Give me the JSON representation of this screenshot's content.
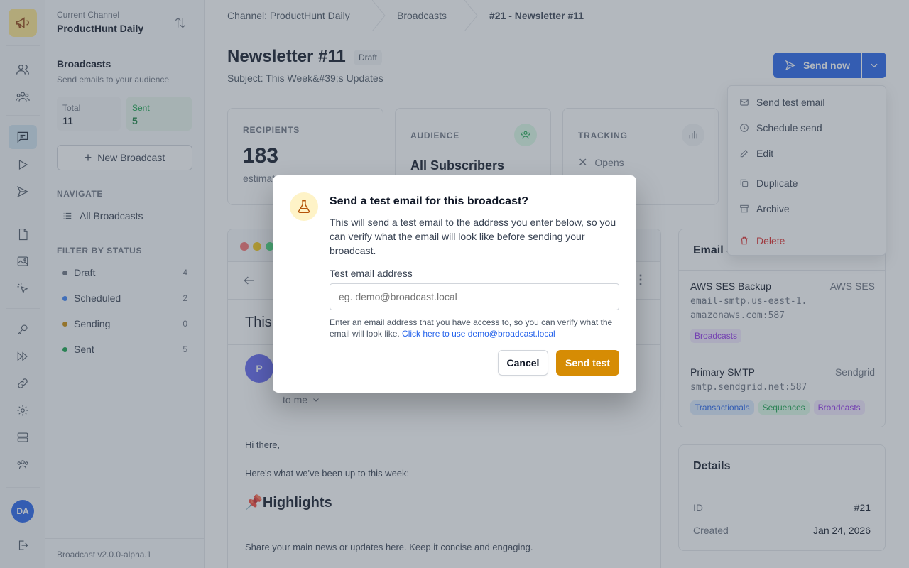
{
  "rail": {
    "avatar": "DA"
  },
  "sidebar": {
    "channel_caption": "Current Channel",
    "channel_name": "ProductHunt Daily",
    "section_title": "Broadcasts",
    "section_sub": "Send emails to your audience",
    "stats": {
      "total_label": "Total",
      "total_value": "11",
      "sent_label": "Sent",
      "sent_value": "5"
    },
    "new_button": "New Broadcast",
    "navigate_label": "NAVIGATE",
    "all_broadcasts": "All Broadcasts",
    "filter_label": "FILTER BY STATUS",
    "statuses": [
      {
        "label": "Draft",
        "count": "4",
        "color": "#6b7280"
      },
      {
        "label": "Scheduled",
        "count": "2",
        "color": "#3b82f6"
      },
      {
        "label": "Sending",
        "count": "0",
        "color": "#ca8a04"
      },
      {
        "label": "Sent",
        "count": "5",
        "color": "#16a34a"
      }
    ],
    "version": "Broadcast v2.0.0-alpha.1"
  },
  "breadcrumb": {
    "channel": "Channel: ProductHunt Daily",
    "broadcasts": "Broadcasts",
    "current": "#21 - Newsletter #11"
  },
  "header": {
    "title": "Newsletter #11",
    "badge": "Draft",
    "subject": "Subject: This Week&#39;s Updates",
    "send_now": "Send now"
  },
  "menu": {
    "items": [
      "Send test email",
      "Schedule send",
      "Edit",
      "Duplicate",
      "Archive",
      "Delete"
    ]
  },
  "stats_cards": {
    "recipients_label": "RECIPIENTS",
    "recipients_value": "183",
    "recipients_sub": "estimated",
    "audience_label": "AUDIENCE",
    "audience_value": "All Subscribers",
    "tracking_label": "TRACKING",
    "tracking_opens": "Opens"
  },
  "preview": {
    "subject_snippet": "This",
    "sender_initial": "P",
    "to_me": "to me",
    "greeting": "Hi there,",
    "intro": "Here's what we've been up to this week:",
    "highlights": "📌Highlights",
    "body": "Share your main news or updates here. Keep it concise and engaging."
  },
  "servers": {
    "title": "Email S",
    "items": [
      {
        "name": "AWS SES Backup",
        "provider": "AWS SES",
        "host": "email-smtp.us-east-1.amazonaws.com:587",
        "tags": [
          "Broadcasts"
        ]
      },
      {
        "name": "Primary SMTP",
        "provider": "Sendgrid",
        "host": "smtp.sendgrid.net:587",
        "tags": [
          "Transactionals",
          "Sequences",
          "Broadcasts"
        ]
      }
    ]
  },
  "details": {
    "title": "Details",
    "id_label": "ID",
    "id_value": "#21",
    "created_label": "Created",
    "created_value": "Jan 24, 2026"
  },
  "modal": {
    "title": "Send a test email for this broadcast?",
    "description": "This will send a test email to the address you enter below, so you can verify what the email will look like before sending your broadcast.",
    "field_label": "Test email address",
    "placeholder": "eg. demo@broadcast.local",
    "help_text": "Enter an email address that you have access to, so you can verify what the email will look like.",
    "help_link": "Click here to use demo@broadcast.local",
    "cancel": "Cancel",
    "send": "Send test"
  },
  "colors": {
    "brand": "#d68c04",
    "primary": "#2563eb",
    "danger": "#dc2626"
  }
}
